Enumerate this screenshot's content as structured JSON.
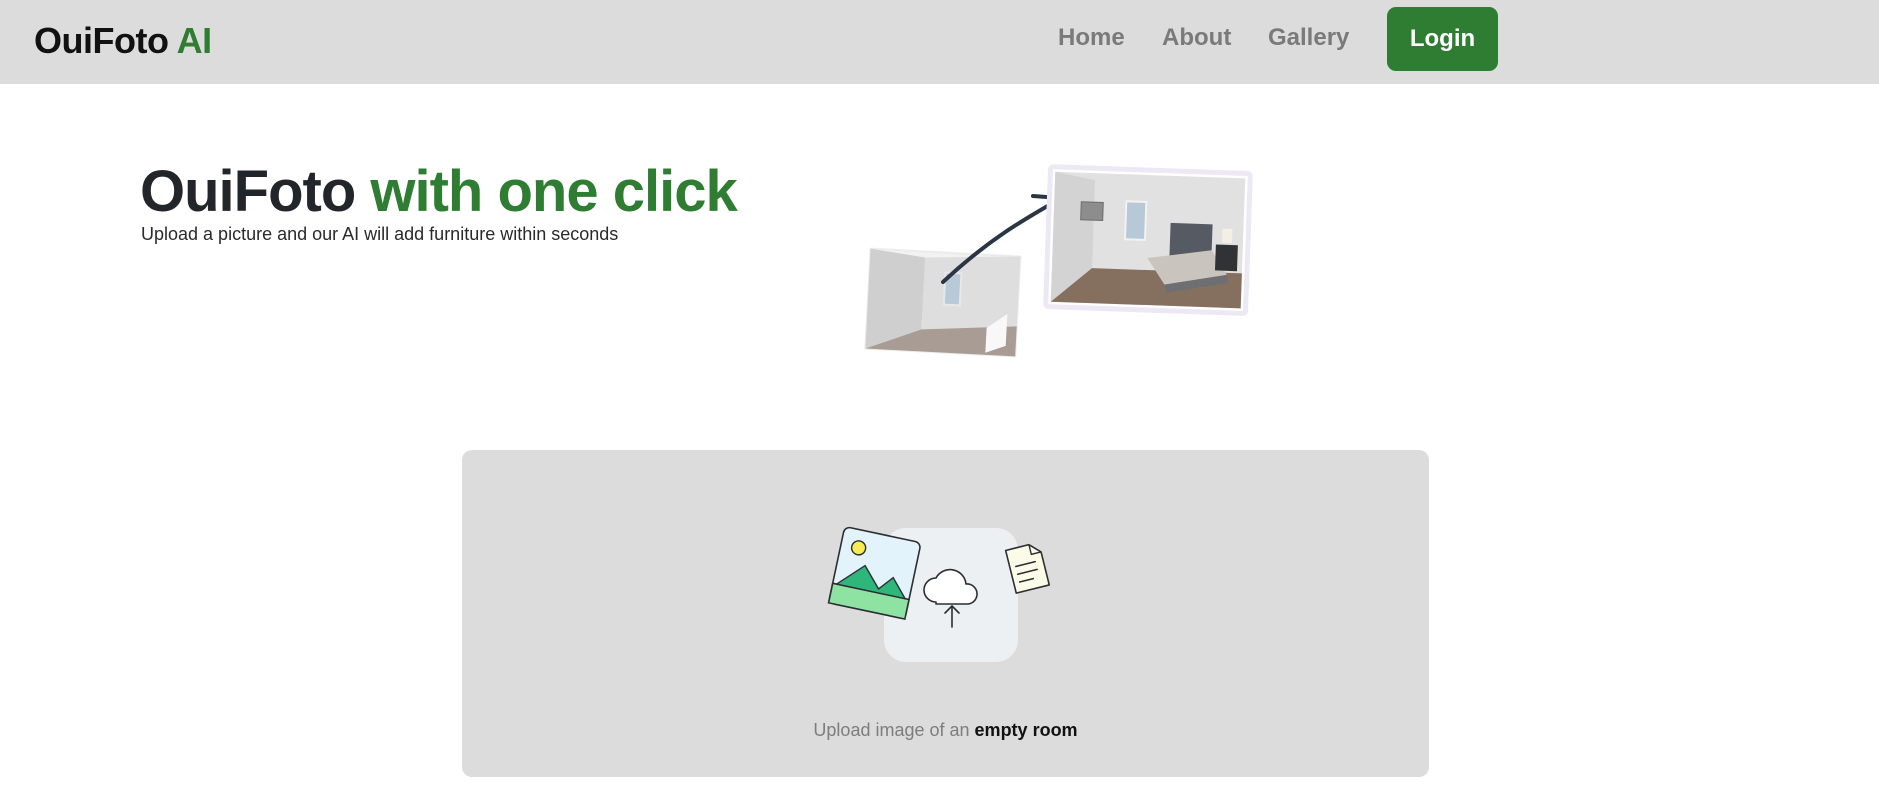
{
  "navbar": {
    "brand": {
      "name": "OuiFoto",
      "accent": "AI"
    },
    "links": [
      {
        "label": "Home"
      },
      {
        "label": "About"
      },
      {
        "label": "Gallery"
      }
    ],
    "login_label": "Login"
  },
  "hero": {
    "title_main": "OuiFoto",
    "title_accent": "with one click",
    "subtitle": "Upload a picture and our AI will add furniture within seconds"
  },
  "upload": {
    "caption_prefix": "Upload image of an",
    "caption_emphasis": "empty room"
  },
  "icons": {
    "illustration": "before-after-room-illustration",
    "image_icon": "image-icon",
    "cloud_upload_icon": "cloud-upload-icon",
    "document_icon": "document-icon"
  },
  "colors": {
    "accent": "#2e7d32",
    "navbar_bg": "#dcdcdc",
    "panel_bg": "#dcdcdc"
  }
}
